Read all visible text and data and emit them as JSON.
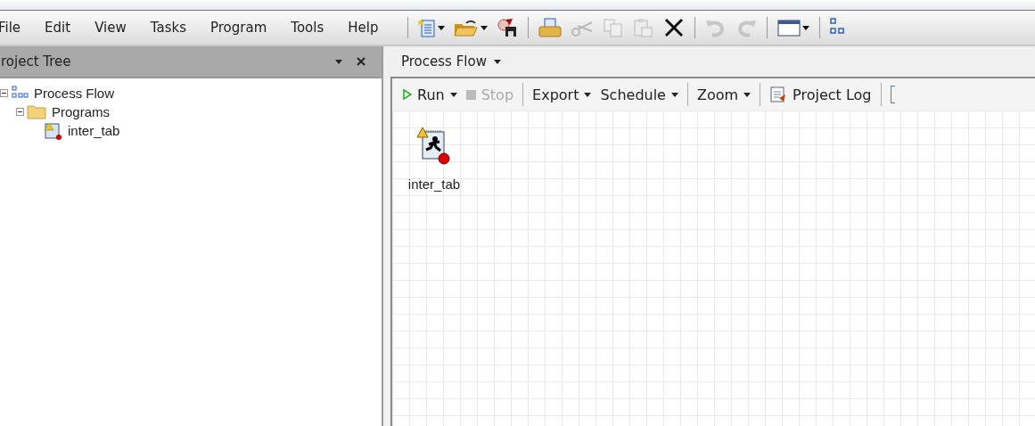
{
  "menu": [
    "File",
    "Edit",
    "View",
    "Tasks",
    "Program",
    "Tools",
    "Help"
  ],
  "toolbar": [
    [
      {
        "kind": "new",
        "dropdown": true,
        "disabled": false
      },
      {
        "kind": "open",
        "dropdown": true,
        "disabled": false
      },
      {
        "kind": "save",
        "dropdown": false,
        "disabled": false
      }
    ],
    [
      {
        "kind": "print",
        "dropdown": false,
        "disabled": false
      },
      {
        "kind": "cut",
        "dropdown": false,
        "disabled": true
      },
      {
        "kind": "copy",
        "dropdown": false,
        "disabled": true
      },
      {
        "kind": "paste",
        "dropdown": false,
        "disabled": true
      },
      {
        "kind": "delete",
        "dropdown": false,
        "disabled": false
      }
    ],
    [
      {
        "kind": "undo",
        "dropdown": false,
        "disabled": true
      },
      {
        "kind": "redo",
        "dropdown": false,
        "disabled": true
      }
    ],
    [
      {
        "kind": "window",
        "dropdown": true,
        "disabled": false
      }
    ],
    [
      {
        "kind": "flow",
        "dropdown": false,
        "disabled": false
      }
    ]
  ],
  "project_tree": {
    "title": "roject Tree",
    "items": [
      {
        "label": "Process Flow",
        "kind": "flow",
        "expanded": true,
        "children": [
          {
            "label": "Programs",
            "kind": "folder",
            "expanded": true,
            "children": [
              {
                "label": "inter_tab",
                "kind": "program"
              }
            ]
          }
        ]
      }
    ]
  },
  "process_flow": {
    "title": "Process Flow",
    "toolbar": [
      [
        {
          "label": "Run",
          "kind": "run",
          "dropdown": true,
          "disabled": false
        },
        {
          "label": "Stop",
          "kind": "stop",
          "dropdown": false,
          "disabled": true
        }
      ],
      [
        {
          "label": "Export",
          "kind": "text",
          "dropdown": true,
          "disabled": false
        },
        {
          "label": "Schedule",
          "kind": "text",
          "dropdown": true,
          "disabled": false
        }
      ],
      [
        {
          "label": "Zoom",
          "kind": "text",
          "dropdown": true,
          "disabled": false
        }
      ],
      [
        {
          "label": "Project Log",
          "kind": "log",
          "dropdown": false,
          "disabled": false
        }
      ]
    ],
    "nodes": [
      {
        "label": "inter_tab",
        "warning": true,
        "error": true
      }
    ]
  }
}
